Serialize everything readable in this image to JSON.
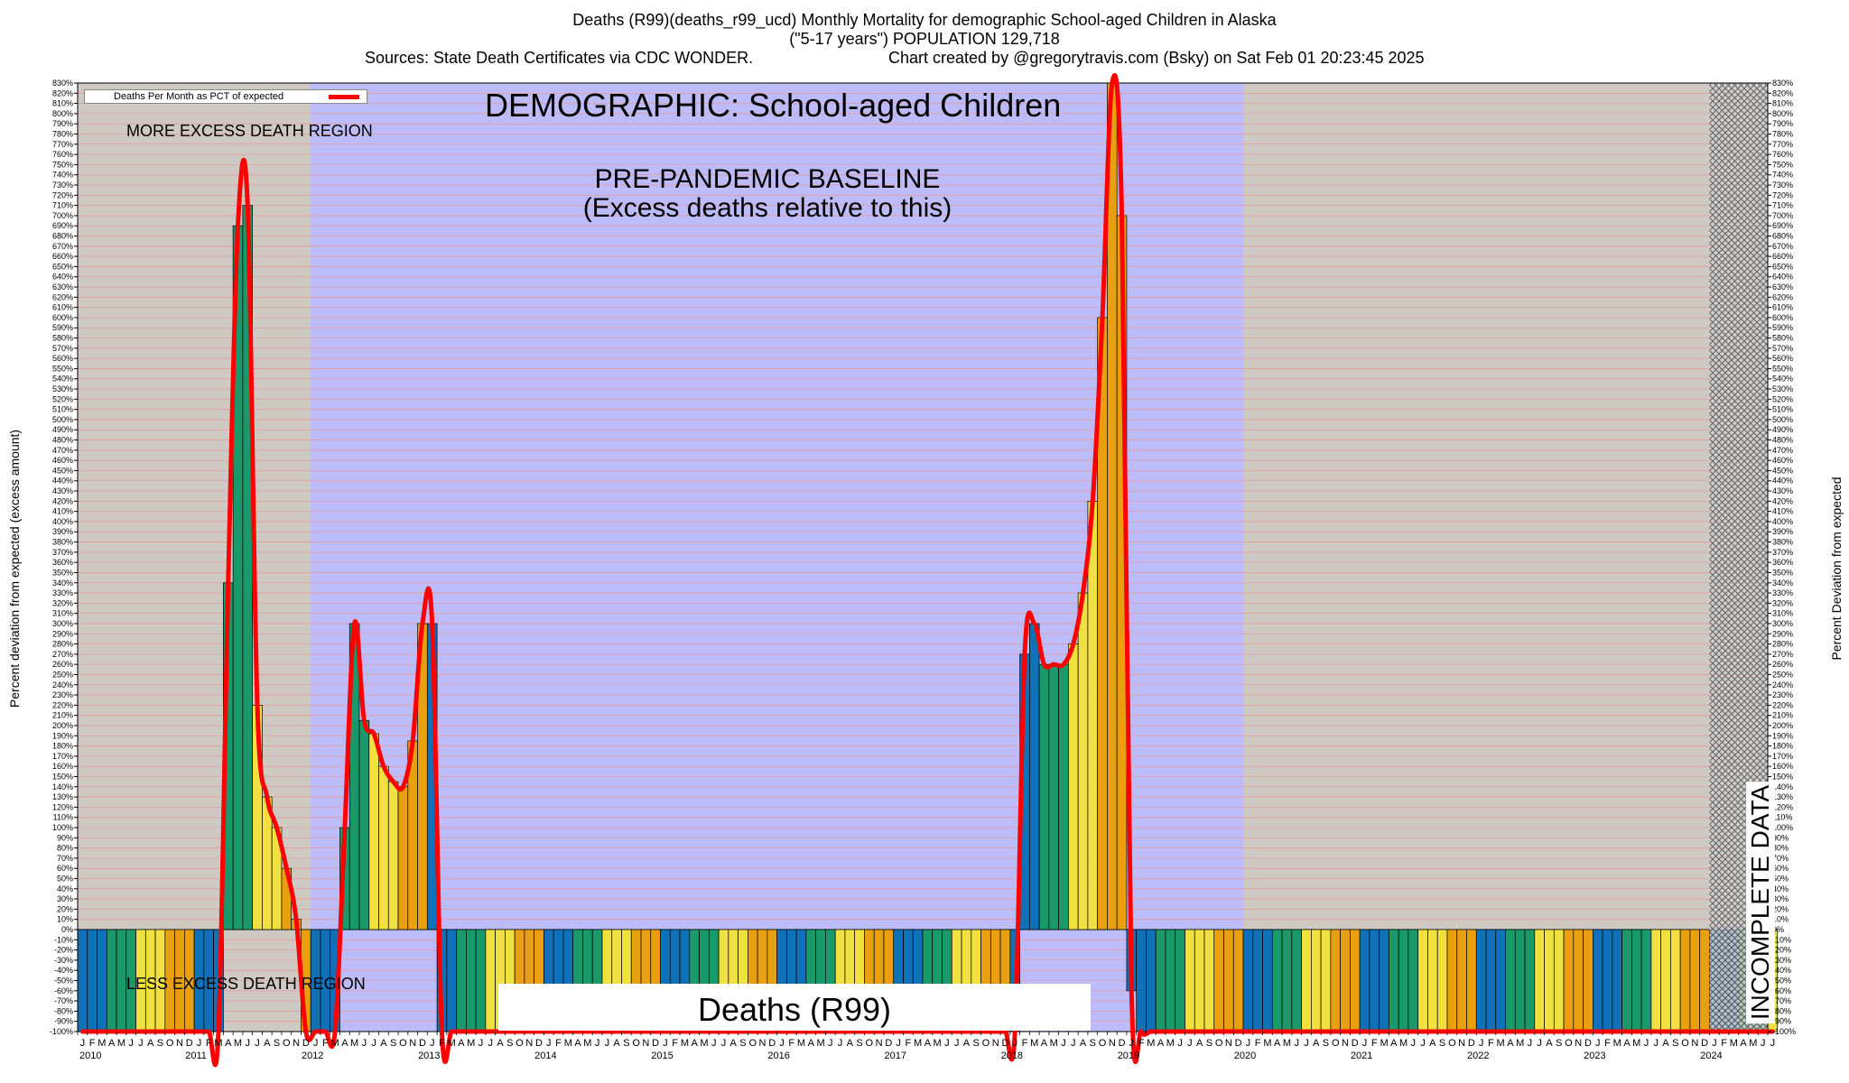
{
  "header": {
    "title_line1": "Deaths (R99)(deaths_r99_ucd) Monthly Mortality for demographic School-aged Children in Alaska",
    "title_line2": "(\"5-17 years\") POPULATION 129,718",
    "title_line3_left": "Sources: State Death Certificates via CDC WONDER.",
    "title_line3_right": "Chart created by @gregorytravis.com (Bsky) on Sat Feb 01 20:23:45 2025"
  },
  "annotations": {
    "demographic": "DEMOGRAPHIC: School-aged Children",
    "baseline_line1": "PRE-PANDEMIC BASELINE",
    "baseline_line2": "(Excess deaths relative to this)",
    "more_excess": "MORE EXCESS DEATH REGION",
    "less_excess": "LESS EXCESS DEATH REGION",
    "incomplete": "INCOMPLETE DATA",
    "cause": "Deaths (R99)"
  },
  "legend": {
    "label": "Deaths Per Month as PCT of expected",
    "color": "#ff0000"
  },
  "colors": {
    "baseline_region": "#bcbcfa",
    "outside_region": "#cfc9c4",
    "grid_line": "#e59a9a",
    "line": "#ff0000",
    "bar_edge": "#000000",
    "month_palette": [
      "#1070b8",
      "#1070b8",
      "#1070b8",
      "#1a9a6a",
      "#1a9a6a",
      "#1a9a6a",
      "#f0e040",
      "#f0e040",
      "#f0e040",
      "#e8a010",
      "#e8a010",
      "#e8a010"
    ]
  },
  "chart_data": {
    "type": "bar",
    "ylabel_left": "Percent deviation from expected (excess amount)",
    "ylabel_right": "Percent Deviation from expected",
    "ylim": [
      -100,
      830
    ],
    "ytick_step": 10,
    "ytick_suffix": "%",
    "year_labels": [
      "2010",
      "2011",
      "2012",
      "2013",
      "2014",
      "2015",
      "2016",
      "2017",
      "2018",
      "2019",
      "2020",
      "2021",
      "2022",
      "2023",
      "2024"
    ],
    "month_letters": [
      "J",
      "F",
      "M",
      "A",
      "M",
      "J",
      "J",
      "A",
      "S",
      "O",
      "N",
      "D"
    ],
    "first_month": "2010-01",
    "last_month": "2024-07",
    "baseline_period": [
      "2012-01",
      "2019-12"
    ],
    "incomplete_from": "2024-01",
    "values": [
      -100,
      -100,
      -100,
      -100,
      -100,
      -100,
      -100,
      -100,
      -100,
      -100,
      -100,
      -100,
      -100,
      -100,
      -100,
      340,
      690,
      710,
      220,
      130,
      100,
      60,
      10,
      -100,
      -100,
      -100,
      -100,
      100,
      300,
      205,
      192,
      160,
      145,
      140,
      185,
      300,
      300,
      -100,
      -100,
      -100,
      -100,
      -100,
      -100,
      -100,
      -100,
      -100,
      -100,
      -100,
      -100,
      -100,
      -100,
      -100,
      -100,
      -100,
      -100,
      -100,
      -100,
      -100,
      -100,
      -100,
      -100,
      -100,
      -100,
      -100,
      -100,
      -100,
      -100,
      -100,
      -100,
      -100,
      -100,
      -100,
      -100,
      -100,
      -100,
      -100,
      -100,
      -100,
      -100,
      -100,
      -100,
      -100,
      -100,
      -100,
      -100,
      -100,
      -100,
      -100,
      -100,
      -100,
      -100,
      -100,
      -100,
      -100,
      -100,
      -100,
      -100,
      270,
      300,
      260,
      260,
      260,
      280,
      330,
      420,
      600,
      830,
      700,
      -60,
      -100,
      -100,
      -100,
      -100,
      -100,
      -100,
      -100,
      -100,
      -100,
      -100,
      -100,
      -100,
      -100,
      -100,
      -100,
      -100,
      -100,
      -100,
      -100,
      -100,
      -100,
      -100,
      -100,
      -100,
      -100,
      -100,
      -100,
      -100,
      -100,
      -100,
      -100,
      -100,
      -100,
      -100,
      -100,
      -100,
      -100,
      -100,
      -100,
      -100,
      -100,
      -100,
      -100,
      -100,
      -100,
      -100,
      -100,
      -100,
      -100,
      -100,
      -100,
      -100,
      -100,
      -100,
      -100,
      -100,
      -100,
      -100,
      -100,
      -100,
      -100,
      -100,
      -100,
      -100,
      -100,
      -100
    ],
    "series": [
      {
        "name": "Deaths Per Month as PCT of expected"
      }
    ]
  }
}
